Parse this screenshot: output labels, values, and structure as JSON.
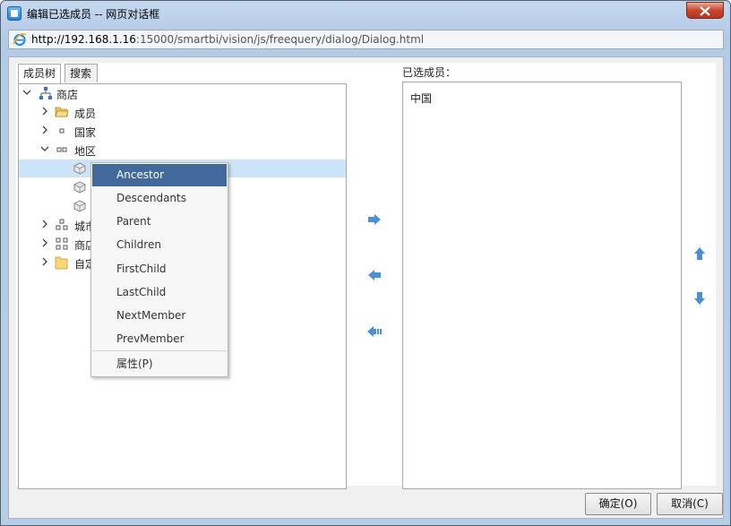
{
  "window": {
    "title": "编辑已选成员 -- 网页对话框"
  },
  "address": {
    "host": "http://192.168.1.16",
    "rest": ":15000/smartbi/vision/js/freequery/dialog/Dialog.html"
  },
  "tabs": [
    {
      "label": "成员树",
      "active": true
    },
    {
      "label": "搜索",
      "active": false
    }
  ],
  "tree": {
    "root": "商店",
    "members": "成员",
    "country": "国家",
    "region": "地区",
    "city": "城市",
    "store": "商店",
    "custom": "自定"
  },
  "context_menu": {
    "items": [
      "Ancestor",
      "Descendants",
      "Parent",
      "Children",
      "FirstChild",
      "LastChild",
      "NextMember",
      "PrevMember"
    ],
    "properties": "属性(P)",
    "highlighted": "Ancestor"
  },
  "selected": {
    "label": "已选成员：",
    "items": [
      "中国"
    ]
  },
  "buttons": {
    "ok": "确定(O)",
    "cancel": "取消(C)"
  },
  "colors": {
    "menu_highlight": "#41699c",
    "row_selected": "#cce4f7",
    "arrow_blue": "#4a90d9"
  }
}
